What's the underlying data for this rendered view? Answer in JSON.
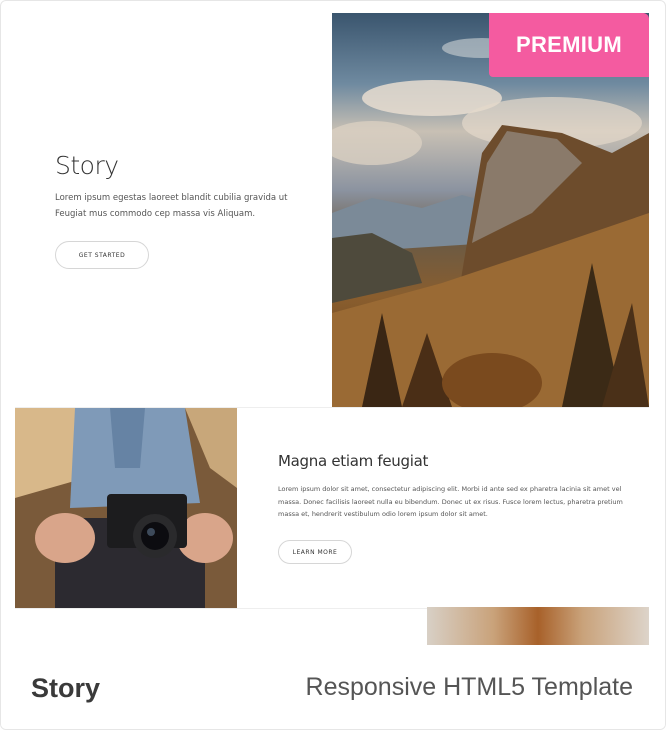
{
  "badge": {
    "label": "PREMIUM",
    "color": "#f45ba0"
  },
  "preview": {
    "hero": {
      "title": "Story",
      "body": "Lorem ipsum egestas laoreet blandit cubilia gravida ut Feugiat mus commodo cep massa vis Aliquam.",
      "button": "GET STARTED"
    },
    "feature": {
      "title": "Magna etiam feugiat",
      "body": "Lorem ipsum dolor sit amet, consectetur adipiscing elit. Morbi id ante sed ex pharetra lacinia sit amet vel massa. Donec facilisis laoreet nulla eu bibendum. Donec ut ex risus. Fusce lorem lectus, pharetra pretium massa et, hendrerit vestibulum odio lorem ipsum dolor sit amet.",
      "button": "LEARN MORE"
    }
  },
  "footer": {
    "name": "Story",
    "description": "Responsive HTML5 Template"
  }
}
